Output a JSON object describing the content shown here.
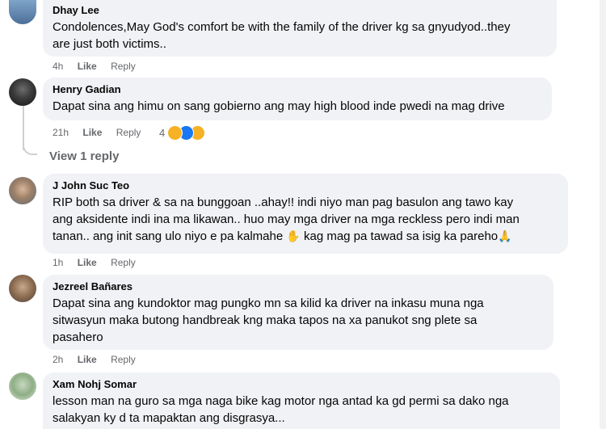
{
  "comments": [
    {
      "name": "Dhay Lee",
      "text_lines": [
        "Condolences,May God's comfort be with the family of the driver kg sa gnyudyod..they",
        "are just both victims.."
      ],
      "time": "4h",
      "like": "Like",
      "reply": "Reply"
    },
    {
      "name": "Henry Gadian",
      "text_lines": [
        "Dapat sina ang himu on sang gobierno ang may high blood inde pwedi na mag drive"
      ],
      "time": "21h",
      "like": "Like",
      "reply": "Reply",
      "reaction_count": "4",
      "reaction_icons": [
        "haha-icon",
        "like-icon",
        "wow-icon"
      ]
    },
    {
      "name": "J John Suc Teo",
      "text_lines": [
        "RIP both sa driver & sa na bunggoan ..ahay!! indi niyo man pag basulon ang tawo kay",
        "ang aksidente indi ina ma likawan.. huo may mga driver na mga reckless pero indi man",
        "tanan.. ang init sang ulo niyo e pa kalmahe",
        "kag mag pa tawad sa isig ka pareho"
      ],
      "emoji_1": "✋",
      "emoji_2": "🙏",
      "time": "1h",
      "like": "Like",
      "reply": "Reply"
    },
    {
      "name": "Jezreel Bañares",
      "text_lines": [
        "Dapat sina ang kundoktor mag pungko mn sa kilid ka driver na inkasu muna nga",
        "sitwasyun maka butong handbreak kng maka tapos na xa panukot sng plete sa",
        "pasahero"
      ],
      "time": "2h",
      "like": "Like",
      "reply": "Reply"
    },
    {
      "name": "Xam Nohj Somar",
      "text_lines": [
        "lesson man na guro sa mga naga bike kag motor nga antad ka gd permi sa dako nga",
        "salakyan ky d ta mapaktan ang disgrasya..."
      ]
    }
  ],
  "view_replies": "View 1 reply",
  "colors": {
    "bubble": "#f0f2f5",
    "meta": "#65676b",
    "text": "#050505"
  }
}
